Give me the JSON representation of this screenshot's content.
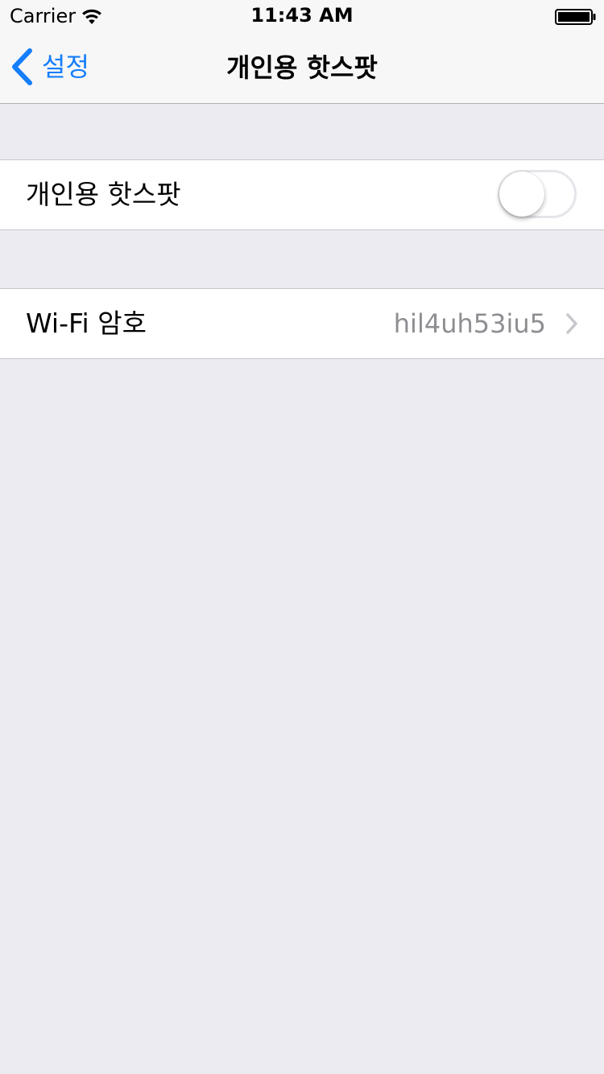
{
  "status_bar": {
    "carrier": "Carrier",
    "time": "11:43 AM",
    "icons": [
      "wifi-icon",
      "battery-icon"
    ]
  },
  "nav_bar": {
    "back_label": "설정",
    "back_icon": "chevron-left-icon",
    "title": "개인용 핫스팟"
  },
  "settings": {
    "hotspot": {
      "label": "개인용 핫스팟",
      "toggle_on": false
    },
    "wifi_password": {
      "label": "Wi-Fi 암호",
      "value": "hil4uh53iu5",
      "icon": "chevron-right-icon"
    }
  },
  "colors": {
    "accent": "#157efb",
    "background": "#ebebf1",
    "cell": "#ffffff",
    "secondary_text": "#8e8e93"
  }
}
